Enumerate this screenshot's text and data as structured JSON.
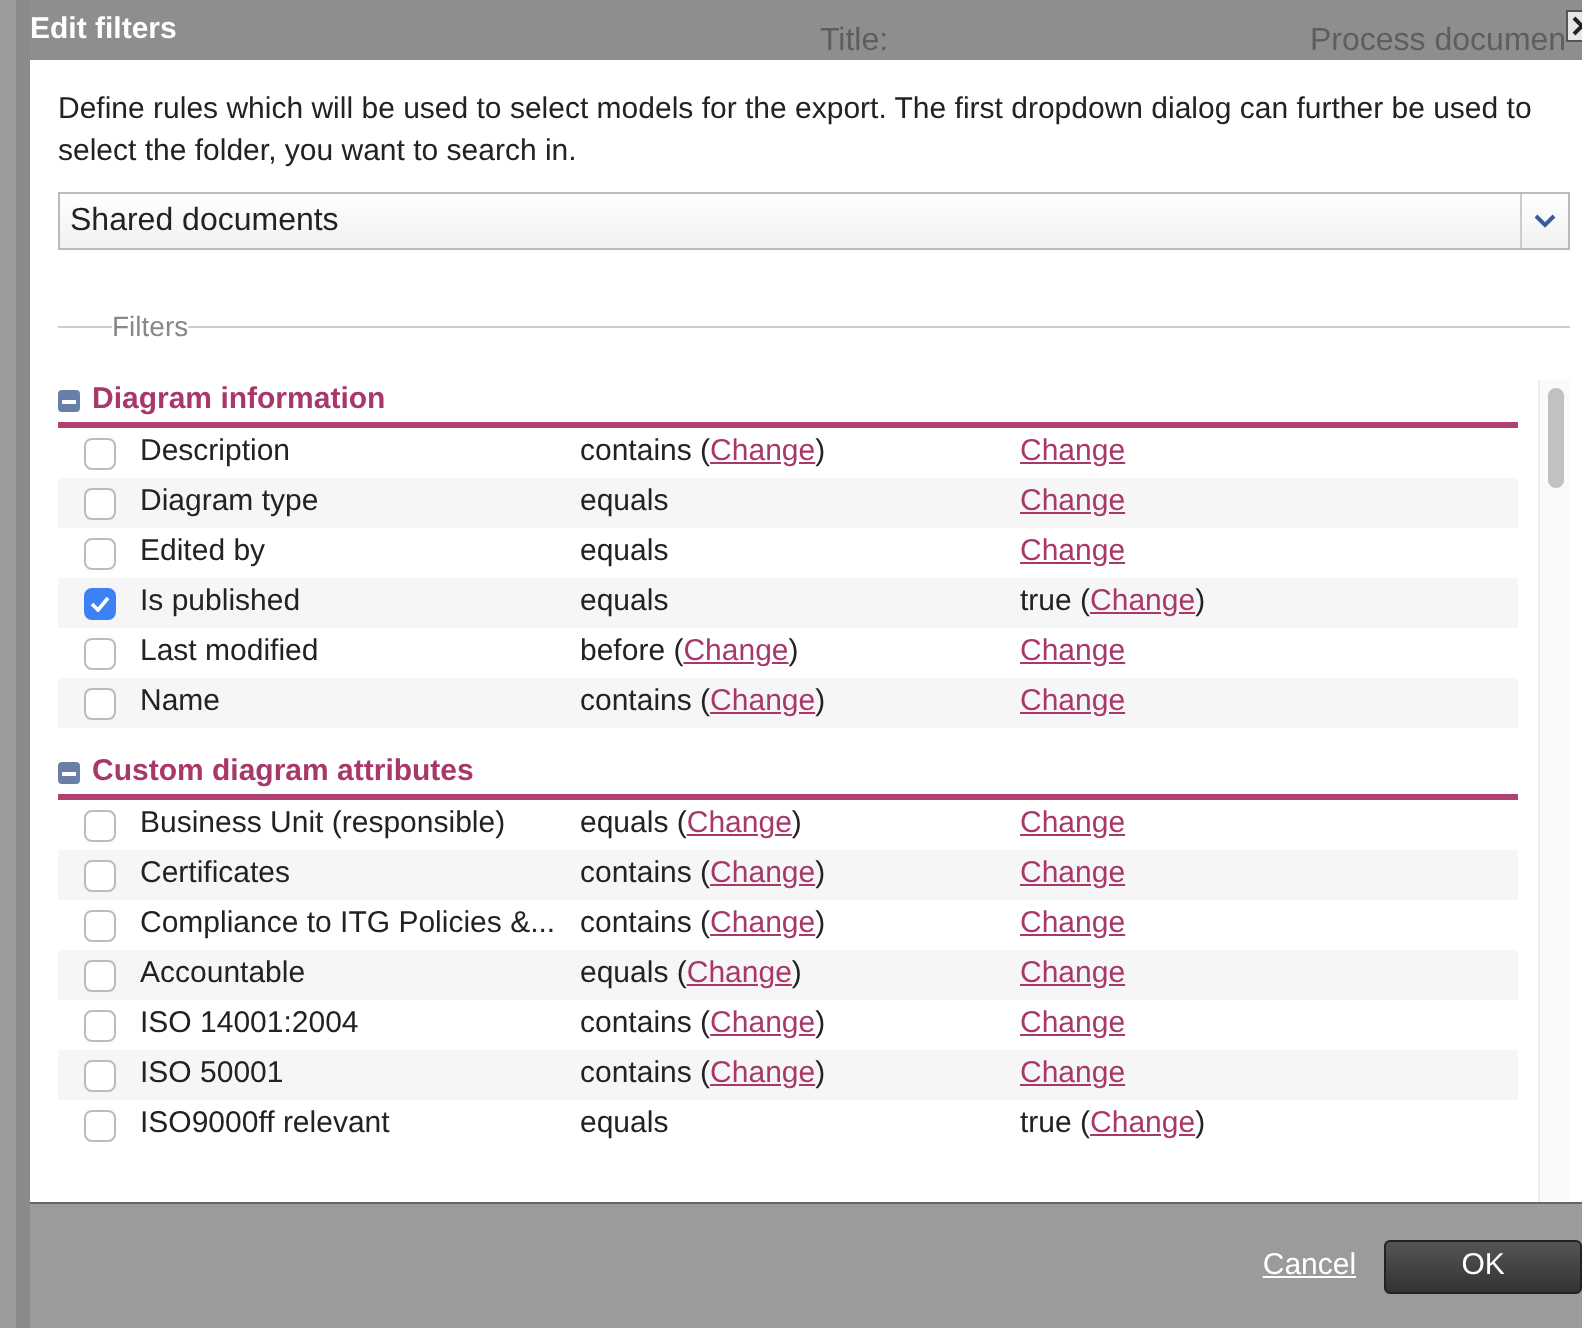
{
  "background": {
    "texts": [
      "Title:",
      "Process documen"
    ]
  },
  "dialog": {
    "title": "Edit filters",
    "description": "Define rules which will be used to select models for the export. The first dropdown dialog can further be used to select the folder, you want to search in.",
    "folder_dropdown": {
      "value": "Shared documents"
    },
    "filters_legend": "Filters",
    "sections": [
      {
        "title": "Diagram information",
        "expanded": true,
        "rows": [
          {
            "name": "Description",
            "checked": false,
            "operator": [
              {
                "kind": "text",
                "text": "contains ("
              },
              {
                "kind": "link",
                "text": "Change"
              },
              {
                "kind": "text",
                "text": ")"
              }
            ],
            "value": [
              {
                "kind": "link",
                "text": "Change"
              }
            ]
          },
          {
            "name": "Diagram type",
            "checked": false,
            "operator": [
              {
                "kind": "text",
                "text": "equals"
              }
            ],
            "value": [
              {
                "kind": "link",
                "text": "Change"
              }
            ]
          },
          {
            "name": "Edited by",
            "checked": false,
            "operator": [
              {
                "kind": "text",
                "text": "equals"
              }
            ],
            "value": [
              {
                "kind": "link",
                "text": "Change"
              }
            ]
          },
          {
            "name": "Is published",
            "checked": true,
            "operator": [
              {
                "kind": "text",
                "text": "equals"
              }
            ],
            "value": [
              {
                "kind": "text",
                "text": "true ("
              },
              {
                "kind": "link",
                "text": "Change"
              },
              {
                "kind": "text",
                "text": ")"
              }
            ]
          },
          {
            "name": "Last modified",
            "checked": false,
            "operator": [
              {
                "kind": "text",
                "text": "before ("
              },
              {
                "kind": "link",
                "text": "Change"
              },
              {
                "kind": "text",
                "text": ")"
              }
            ],
            "value": [
              {
                "kind": "link",
                "text": "Change"
              }
            ]
          },
          {
            "name": "Name",
            "checked": false,
            "operator": [
              {
                "kind": "text",
                "text": "contains ("
              },
              {
                "kind": "link",
                "text": "Change"
              },
              {
                "kind": "text",
                "text": ")"
              }
            ],
            "value": [
              {
                "kind": "link",
                "text": "Change"
              }
            ]
          }
        ]
      },
      {
        "title": "Custom diagram attributes",
        "expanded": true,
        "rows": [
          {
            "name": "Business Unit (responsible)",
            "checked": false,
            "operator": [
              {
                "kind": "text",
                "text": "equals ("
              },
              {
                "kind": "link",
                "text": "Change"
              },
              {
                "kind": "text",
                "text": ")"
              }
            ],
            "value": [
              {
                "kind": "link",
                "text": "Change"
              }
            ]
          },
          {
            "name": "Certificates",
            "checked": false,
            "operator": [
              {
                "kind": "text",
                "text": "contains ("
              },
              {
                "kind": "link",
                "text": "Change"
              },
              {
                "kind": "text",
                "text": ")"
              }
            ],
            "value": [
              {
                "kind": "link",
                "text": "Change"
              }
            ]
          },
          {
            "name": "Compliance to ITG Policies &...",
            "checked": false,
            "operator": [
              {
                "kind": "text",
                "text": "contains ("
              },
              {
                "kind": "link",
                "text": "Change"
              },
              {
                "kind": "text",
                "text": ")"
              }
            ],
            "value": [
              {
                "kind": "link",
                "text": "Change"
              }
            ]
          },
          {
            "name": "Accountable",
            "checked": false,
            "operator": [
              {
                "kind": "text",
                "text": "equals ("
              },
              {
                "kind": "link",
                "text": "Change"
              },
              {
                "kind": "text",
                "text": ")"
              }
            ],
            "value": [
              {
                "kind": "link",
                "text": "Change"
              }
            ]
          },
          {
            "name": "ISO 14001:2004",
            "checked": false,
            "operator": [
              {
                "kind": "text",
                "text": "contains ("
              },
              {
                "kind": "link",
                "text": "Change"
              },
              {
                "kind": "text",
                "text": ")"
              }
            ],
            "value": [
              {
                "kind": "link",
                "text": "Change"
              }
            ]
          },
          {
            "name": "ISO 50001",
            "checked": false,
            "operator": [
              {
                "kind": "text",
                "text": "contains ("
              },
              {
                "kind": "link",
                "text": "Change"
              },
              {
                "kind": "text",
                "text": ")"
              }
            ],
            "value": [
              {
                "kind": "link",
                "text": "Change"
              }
            ]
          },
          {
            "name": "ISO9000ff relevant",
            "checked": false,
            "operator": [
              {
                "kind": "text",
                "text": "equals"
              }
            ],
            "value": [
              {
                "kind": "text",
                "text": "true ("
              },
              {
                "kind": "link",
                "text": "Change"
              },
              {
                "kind": "text",
                "text": ")"
              }
            ]
          }
        ]
      }
    ],
    "footer": {
      "cancel": "Cancel",
      "ok": "OK"
    }
  }
}
